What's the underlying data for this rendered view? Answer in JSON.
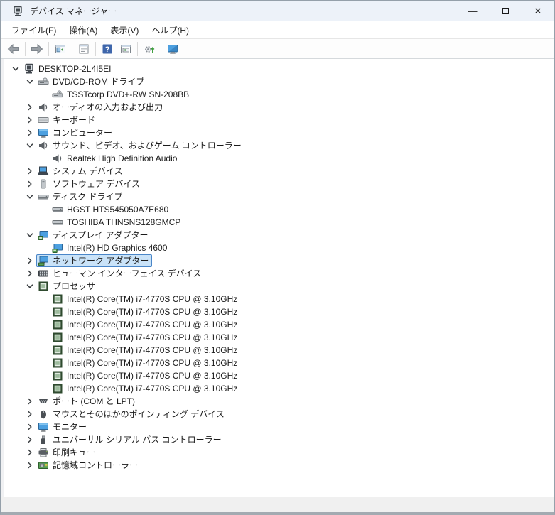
{
  "window": {
    "title": "デバイス マネージャー",
    "controls": {
      "minimize": "—",
      "close": "✕"
    }
  },
  "menu": {
    "items": [
      {
        "name": "file",
        "label": "ファイル(F)"
      },
      {
        "name": "action",
        "label": "操作(A)"
      },
      {
        "name": "view",
        "label": "表示(V)"
      },
      {
        "name": "help",
        "label": "ヘルプ(H)"
      }
    ]
  },
  "toolbar": {
    "buttons": [
      {
        "name": "back-button",
        "icon": "back-arrow-icon",
        "sep_after": true
      },
      {
        "name": "forward-button",
        "icon": "forward-arrow-icon",
        "sep_after": true
      },
      {
        "name": "console-tree-button",
        "icon": "console-tree-icon",
        "sep_after": true
      },
      {
        "name": "properties-button",
        "icon": "properties-icon",
        "sep_after": true
      },
      {
        "name": "help-button",
        "icon": "help-icon",
        "sep_after": false
      },
      {
        "name": "action-pane-button",
        "icon": "action-pane-icon",
        "sep_after": true
      },
      {
        "name": "scan-hardware-button",
        "icon": "scan-hardware-icon",
        "sep_after": true
      },
      {
        "name": "devices-button",
        "icon": "device-monitor-icon",
        "sep_after": false
      }
    ]
  },
  "tree": {
    "items": [
      {
        "level": 0,
        "state": "expanded",
        "icon": "computer",
        "label": "DESKTOP-2L4I5EI"
      },
      {
        "level": 1,
        "state": "expanded",
        "icon": "cd-drive",
        "label": "DVD/CD-ROM ドライブ"
      },
      {
        "level": 2,
        "state": null,
        "icon": "cd-drive",
        "label": "TSSTcorp DVD+-RW SN-208BB"
      },
      {
        "level": 1,
        "state": "collapsed",
        "icon": "speaker",
        "label": "オーディオの入力および出力"
      },
      {
        "level": 1,
        "state": "collapsed",
        "icon": "keyboard",
        "label": "キーボード"
      },
      {
        "level": 1,
        "state": "collapsed",
        "icon": "monitor",
        "label": "コンピューター"
      },
      {
        "level": 1,
        "state": "expanded",
        "icon": "speaker",
        "label": "サウンド、ビデオ、およびゲーム コントローラー"
      },
      {
        "level": 2,
        "state": null,
        "icon": "speaker",
        "label": "Realtek High Definition Audio"
      },
      {
        "level": 1,
        "state": "collapsed",
        "icon": "system-device",
        "label": "システム デバイス"
      },
      {
        "level": 1,
        "state": "collapsed",
        "icon": "software-device",
        "label": "ソフトウェア デバイス"
      },
      {
        "level": 1,
        "state": "expanded",
        "icon": "disk-drive",
        "label": "ディスク ドライブ"
      },
      {
        "level": 2,
        "state": null,
        "icon": "disk-drive",
        "label": "HGST HTS545050A7E680"
      },
      {
        "level": 2,
        "state": null,
        "icon": "disk-drive",
        "label": "TOSHIBA THNSNS128GMCP"
      },
      {
        "level": 1,
        "state": "expanded",
        "icon": "display-adapter",
        "label": "ディスプレイ アダプター"
      },
      {
        "level": 2,
        "state": null,
        "icon": "display-adapter",
        "label": "Intel(R) HD Graphics 4600"
      },
      {
        "level": 1,
        "state": "collapsed",
        "icon": "network-adapter",
        "label": "ネットワーク アダプター",
        "selected": true
      },
      {
        "level": 1,
        "state": "collapsed",
        "icon": "hid",
        "label": "ヒューマン インターフェイス デバイス"
      },
      {
        "level": 1,
        "state": "expanded",
        "icon": "processor",
        "label": "プロセッサ"
      },
      {
        "level": 2,
        "state": null,
        "icon": "processor",
        "label": "Intel(R) Core(TM) i7-4770S CPU @ 3.10GHz"
      },
      {
        "level": 2,
        "state": null,
        "icon": "processor",
        "label": "Intel(R) Core(TM) i7-4770S CPU @ 3.10GHz"
      },
      {
        "level": 2,
        "state": null,
        "icon": "processor",
        "label": "Intel(R) Core(TM) i7-4770S CPU @ 3.10GHz"
      },
      {
        "level": 2,
        "state": null,
        "icon": "processor",
        "label": "Intel(R) Core(TM) i7-4770S CPU @ 3.10GHz"
      },
      {
        "level": 2,
        "state": null,
        "icon": "processor",
        "label": "Intel(R) Core(TM) i7-4770S CPU @ 3.10GHz"
      },
      {
        "level": 2,
        "state": null,
        "icon": "processor",
        "label": "Intel(R) Core(TM) i7-4770S CPU @ 3.10GHz"
      },
      {
        "level": 2,
        "state": null,
        "icon": "processor",
        "label": "Intel(R) Core(TM) i7-4770S CPU @ 3.10GHz"
      },
      {
        "level": 2,
        "state": null,
        "icon": "processor",
        "label": "Intel(R) Core(TM) i7-4770S CPU @ 3.10GHz"
      },
      {
        "level": 1,
        "state": "collapsed",
        "icon": "port",
        "label": "ポート (COM と LPT)"
      },
      {
        "level": 1,
        "state": "collapsed",
        "icon": "mouse",
        "label": "マウスとそのほかのポインティング デバイス"
      },
      {
        "level": 1,
        "state": "collapsed",
        "icon": "monitor",
        "label": "モニター"
      },
      {
        "level": 1,
        "state": "collapsed",
        "icon": "usb",
        "label": "ユニバーサル シリアル バス コントローラー"
      },
      {
        "level": 1,
        "state": "collapsed",
        "icon": "printer",
        "label": "印刷キュー"
      },
      {
        "level": 1,
        "state": "collapsed",
        "icon": "storage",
        "label": "記憶域コントローラー"
      }
    ]
  },
  "statusbar": {
    "text": ""
  },
  "colors": {
    "titlebar_bg": "#edf2f9",
    "selection_bg": "#cae3f8",
    "selection_border": "#4a86c8",
    "help_blue": "#3e66ab",
    "processor_green": "#2f4b2f",
    "monitor_blue": "#4da0e0"
  }
}
